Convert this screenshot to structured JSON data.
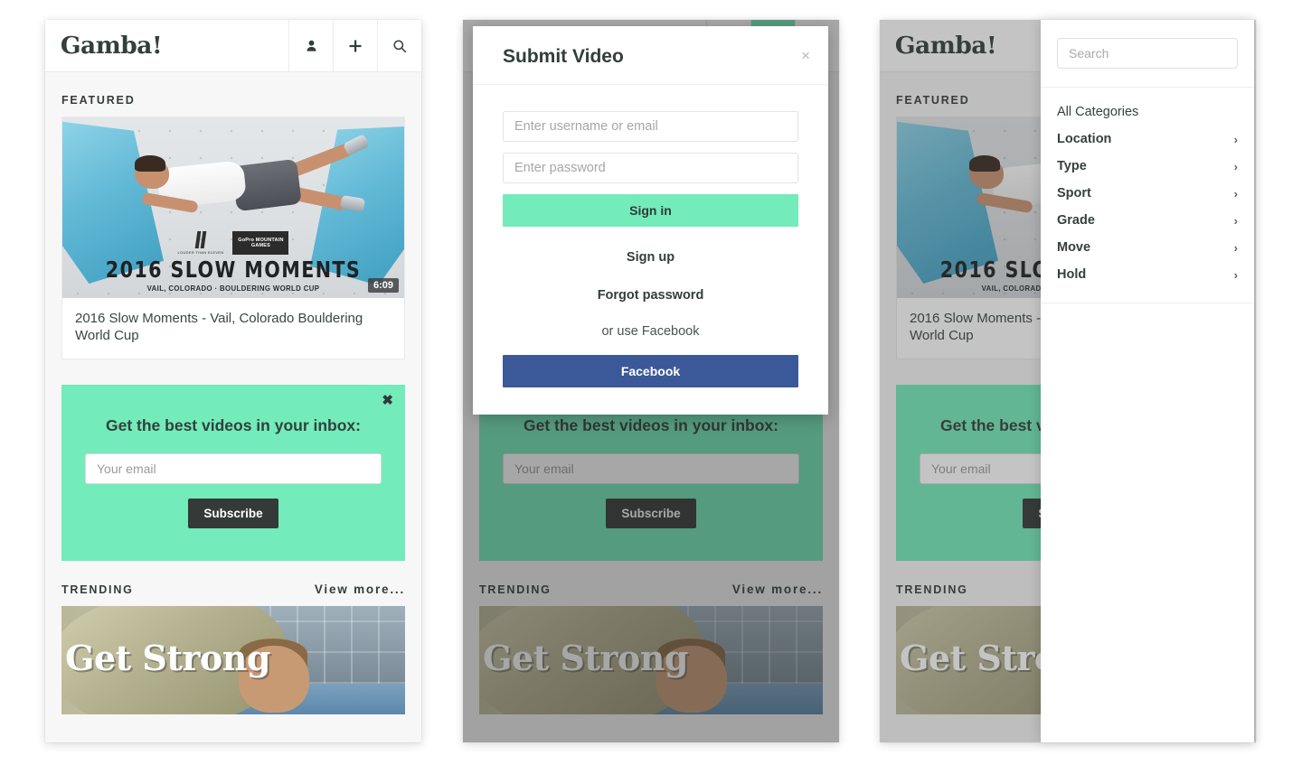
{
  "site": {
    "logo": "Gamba!",
    "header_icons": [
      {
        "name": "user-icon",
        "label": "Account"
      },
      {
        "name": "plus-icon",
        "label": "Submit"
      },
      {
        "name": "search-icon",
        "label": "Search"
      }
    ]
  },
  "featured": {
    "section_label": "FEATURED",
    "thumb": {
      "title_line": "2016 SLOW MOMENTS",
      "subtitle_line": "VAIL, COLORADO · BOULDERING WORLD CUP",
      "brand_left": "LOUDER THAN ELEVEN",
      "brand_right": "GoPro MOUNTAIN GAMES",
      "duration": "6:09"
    },
    "card_title": "2016 Slow Moments - Vail, Colorado Bouldering World Cup"
  },
  "subscribe": {
    "heading": "Get the best videos in your inbox:",
    "email_placeholder": "Your email",
    "email_value": "",
    "button_label": "Subscribe",
    "close_label": "✖",
    "bg_color": "#73EBBA"
  },
  "trending": {
    "section_label": "TRENDING",
    "view_more": "View more...",
    "thumb_text": "Get Strong"
  },
  "modal": {
    "title": "Submit Video",
    "close_label": "×",
    "username_placeholder": "Enter username or email",
    "username_value": "",
    "password_placeholder": "Enter password",
    "password_value": "",
    "signin_label": "Sign in",
    "signup_label": "Sign up",
    "forgot_label": "Forgot password",
    "or_label": "or use Facebook",
    "facebook_label": "Facebook",
    "accent_color": "#73EBBA",
    "facebook_color": "#3b5998"
  },
  "search_panel": {
    "placeholder": "Search",
    "value": "",
    "all_categories": "All Categories",
    "categories": [
      {
        "label": "Location",
        "chevron": "›"
      },
      {
        "label": "Type",
        "chevron": "›"
      },
      {
        "label": "Sport",
        "chevron": "›"
      },
      {
        "label": "Grade",
        "chevron": "›"
      },
      {
        "label": "Move",
        "chevron": "›"
      },
      {
        "label": "Hold",
        "chevron": "›"
      }
    ]
  }
}
